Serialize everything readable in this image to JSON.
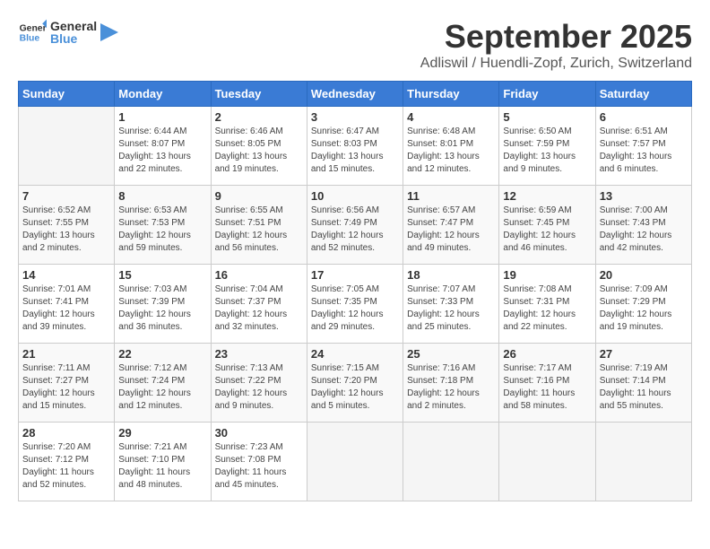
{
  "header": {
    "logo_general": "General",
    "logo_blue": "Blue",
    "month_title": "September 2025",
    "location": "Adliswil / Huendli-Zopf, Zurich, Switzerland"
  },
  "weekdays": [
    "Sunday",
    "Monday",
    "Tuesday",
    "Wednesday",
    "Thursday",
    "Friday",
    "Saturday"
  ],
  "weeks": [
    [
      {
        "day": "",
        "info": ""
      },
      {
        "day": "1",
        "info": "Sunrise: 6:44 AM\nSunset: 8:07 PM\nDaylight: 13 hours\nand 22 minutes."
      },
      {
        "day": "2",
        "info": "Sunrise: 6:46 AM\nSunset: 8:05 PM\nDaylight: 13 hours\nand 19 minutes."
      },
      {
        "day": "3",
        "info": "Sunrise: 6:47 AM\nSunset: 8:03 PM\nDaylight: 13 hours\nand 15 minutes."
      },
      {
        "day": "4",
        "info": "Sunrise: 6:48 AM\nSunset: 8:01 PM\nDaylight: 13 hours\nand 12 minutes."
      },
      {
        "day": "5",
        "info": "Sunrise: 6:50 AM\nSunset: 7:59 PM\nDaylight: 13 hours\nand 9 minutes."
      },
      {
        "day": "6",
        "info": "Sunrise: 6:51 AM\nSunset: 7:57 PM\nDaylight: 13 hours\nand 6 minutes."
      }
    ],
    [
      {
        "day": "7",
        "info": "Sunrise: 6:52 AM\nSunset: 7:55 PM\nDaylight: 13 hours\nand 2 minutes."
      },
      {
        "day": "8",
        "info": "Sunrise: 6:53 AM\nSunset: 7:53 PM\nDaylight: 12 hours\nand 59 minutes."
      },
      {
        "day": "9",
        "info": "Sunrise: 6:55 AM\nSunset: 7:51 PM\nDaylight: 12 hours\nand 56 minutes."
      },
      {
        "day": "10",
        "info": "Sunrise: 6:56 AM\nSunset: 7:49 PM\nDaylight: 12 hours\nand 52 minutes."
      },
      {
        "day": "11",
        "info": "Sunrise: 6:57 AM\nSunset: 7:47 PM\nDaylight: 12 hours\nand 49 minutes."
      },
      {
        "day": "12",
        "info": "Sunrise: 6:59 AM\nSunset: 7:45 PM\nDaylight: 12 hours\nand 46 minutes."
      },
      {
        "day": "13",
        "info": "Sunrise: 7:00 AM\nSunset: 7:43 PM\nDaylight: 12 hours\nand 42 minutes."
      }
    ],
    [
      {
        "day": "14",
        "info": "Sunrise: 7:01 AM\nSunset: 7:41 PM\nDaylight: 12 hours\nand 39 minutes."
      },
      {
        "day": "15",
        "info": "Sunrise: 7:03 AM\nSunset: 7:39 PM\nDaylight: 12 hours\nand 36 minutes."
      },
      {
        "day": "16",
        "info": "Sunrise: 7:04 AM\nSunset: 7:37 PM\nDaylight: 12 hours\nand 32 minutes."
      },
      {
        "day": "17",
        "info": "Sunrise: 7:05 AM\nSunset: 7:35 PM\nDaylight: 12 hours\nand 29 minutes."
      },
      {
        "day": "18",
        "info": "Sunrise: 7:07 AM\nSunset: 7:33 PM\nDaylight: 12 hours\nand 25 minutes."
      },
      {
        "day": "19",
        "info": "Sunrise: 7:08 AM\nSunset: 7:31 PM\nDaylight: 12 hours\nand 22 minutes."
      },
      {
        "day": "20",
        "info": "Sunrise: 7:09 AM\nSunset: 7:29 PM\nDaylight: 12 hours\nand 19 minutes."
      }
    ],
    [
      {
        "day": "21",
        "info": "Sunrise: 7:11 AM\nSunset: 7:27 PM\nDaylight: 12 hours\nand 15 minutes."
      },
      {
        "day": "22",
        "info": "Sunrise: 7:12 AM\nSunset: 7:24 PM\nDaylight: 12 hours\nand 12 minutes."
      },
      {
        "day": "23",
        "info": "Sunrise: 7:13 AM\nSunset: 7:22 PM\nDaylight: 12 hours\nand 9 minutes."
      },
      {
        "day": "24",
        "info": "Sunrise: 7:15 AM\nSunset: 7:20 PM\nDaylight: 12 hours\nand 5 minutes."
      },
      {
        "day": "25",
        "info": "Sunrise: 7:16 AM\nSunset: 7:18 PM\nDaylight: 12 hours\nand 2 minutes."
      },
      {
        "day": "26",
        "info": "Sunrise: 7:17 AM\nSunset: 7:16 PM\nDaylight: 11 hours\nand 58 minutes."
      },
      {
        "day": "27",
        "info": "Sunrise: 7:19 AM\nSunset: 7:14 PM\nDaylight: 11 hours\nand 55 minutes."
      }
    ],
    [
      {
        "day": "28",
        "info": "Sunrise: 7:20 AM\nSunset: 7:12 PM\nDaylight: 11 hours\nand 52 minutes."
      },
      {
        "day": "29",
        "info": "Sunrise: 7:21 AM\nSunset: 7:10 PM\nDaylight: 11 hours\nand 48 minutes."
      },
      {
        "day": "30",
        "info": "Sunrise: 7:23 AM\nSunset: 7:08 PM\nDaylight: 11 hours\nand 45 minutes."
      },
      {
        "day": "",
        "info": ""
      },
      {
        "day": "",
        "info": ""
      },
      {
        "day": "",
        "info": ""
      },
      {
        "day": "",
        "info": ""
      }
    ]
  ]
}
